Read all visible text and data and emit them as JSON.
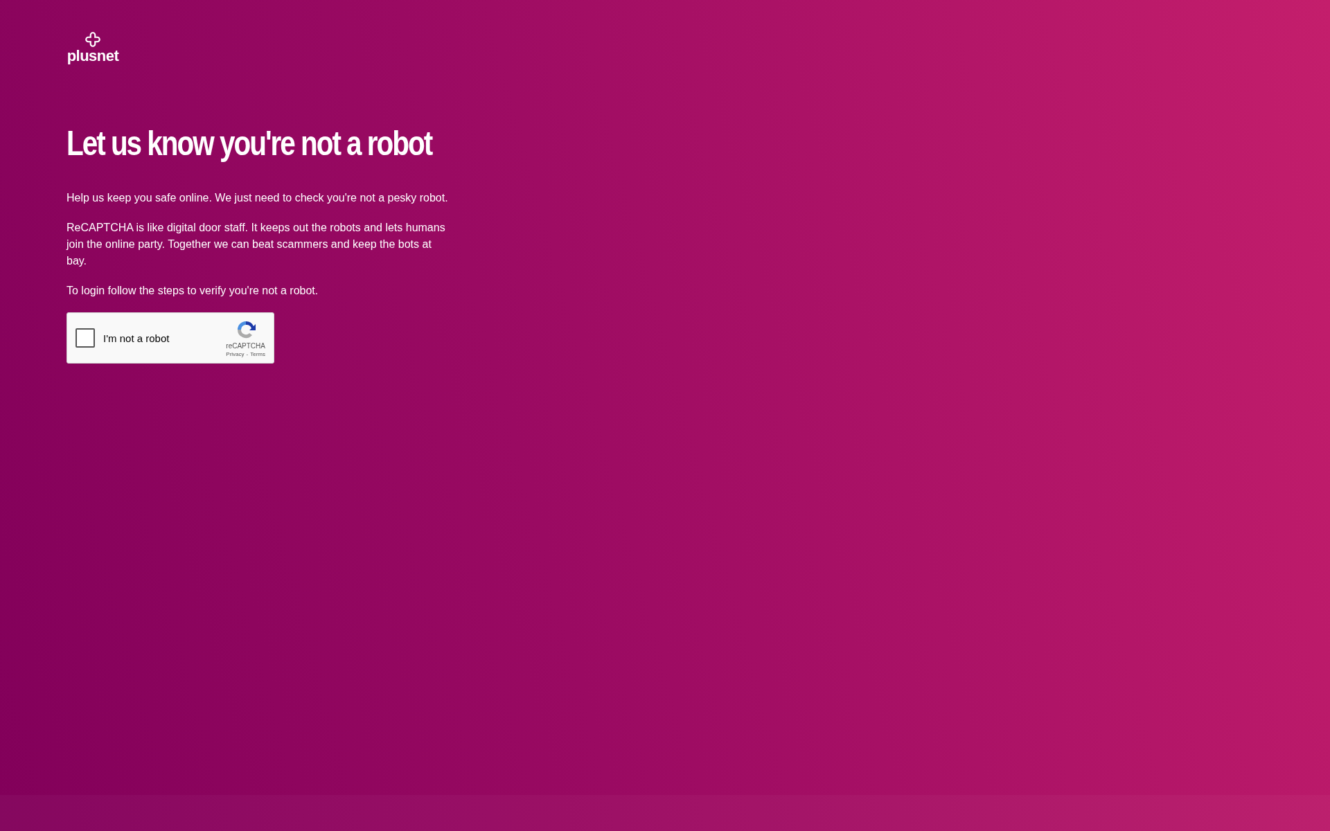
{
  "logo": {
    "text": "plusnet"
  },
  "heading": "Let us know you're not a robot",
  "paragraphs": [
    "Help us keep you safe online. We just need to check you're not a pesky robot.",
    "ReCAPTCHA is like digital door staff. It keeps out the robots and lets humans join the online party. Together we can beat scammers and keep the bots at bay.",
    "To login follow the steps to verify you're not a robot."
  ],
  "captcha": {
    "checked": false,
    "label": "I'm not a robot",
    "brand": "reCAPTCHA",
    "links": [
      "Privacy",
      "Terms"
    ],
    "separator": "-"
  }
}
